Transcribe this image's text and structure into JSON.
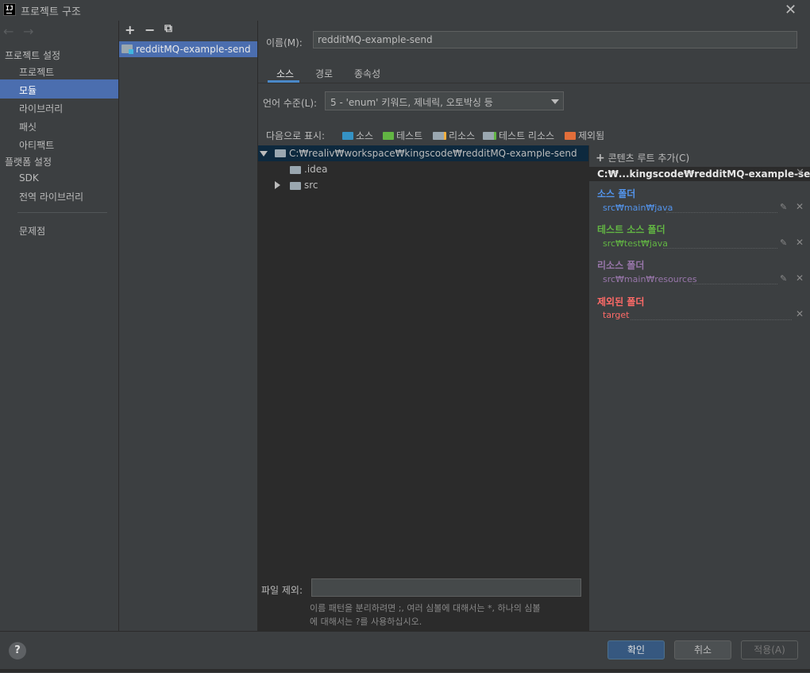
{
  "window": {
    "title": "프로젝트 구조",
    "app_icon_text": "IJ"
  },
  "nav": {
    "project_settings_header": "프로젝트 설정",
    "project_settings_items": [
      "프로젝트",
      "모듈",
      "라이브러리",
      "패싯",
      "아티팩트"
    ],
    "platform_settings_header": "플랫폼 설정",
    "platform_items": [
      "SDK",
      "전역 라이브러리"
    ],
    "problems": "문제점",
    "selected": "모듈"
  },
  "modules": {
    "toolbar": {
      "add": "+",
      "remove": "−",
      "copy": "⧉"
    },
    "items": [
      "redditMQ-example-send"
    ]
  },
  "main": {
    "name_label": "이름(M):",
    "name_value": "redditMQ-example-send",
    "tabs": [
      "소스",
      "경로",
      "종속성"
    ],
    "active_tab": "소스",
    "language_level_label": "언어 수준(L):",
    "language_level_value": "5 - 'enum' 키워드, 제네릭, 오토박싱 등",
    "mark_as_label": "다음으로 표시:",
    "mark_as": [
      {
        "label": "소스",
        "color": "#3592c4"
      },
      {
        "label": "테스트",
        "color": "#62b543"
      },
      {
        "label": "리소스",
        "color": "#9aa7b0"
      },
      {
        "label": "테스트 리소스",
        "color": "#9aa7b0"
      },
      {
        "label": "제외됨",
        "color": "#e05555"
      }
    ],
    "tree": {
      "root": "C:₩realiv₩workspace₩kingscode₩redditMQ-example-send",
      "children": [
        ".idea",
        "src"
      ]
    },
    "exclude_label": "파일 제외:",
    "exclude_value": "",
    "hint_line1": "이름 패턴을 분리하려면 ;, 여러 심볼에 대해서는 *, 하나의 심볼",
    "hint_line2": "에 대해서는 ?를 사용하십시오."
  },
  "content_root": {
    "add_label": "콘텐츠 루트 추가(C)",
    "path": "C:₩...kingscode₩redditMQ-example-send",
    "sections": [
      {
        "title": "소스 폴더",
        "path": "src₩main₩java",
        "color": "#5394ec",
        "editable": true
      },
      {
        "title": "테스트 소스 폴더",
        "path": "src₩test₩java",
        "color": "#62b543",
        "editable": true
      },
      {
        "title": "리소스 폴더",
        "path": "src₩main₩resources",
        "color": "#9876aa",
        "editable": true
      },
      {
        "title": "제외된 폴더",
        "path": "target",
        "color": "#ff6b68",
        "editable": false
      }
    ]
  },
  "footer": {
    "help": "?",
    "ok": "확인",
    "cancel": "취소",
    "apply": "적용(A)"
  }
}
